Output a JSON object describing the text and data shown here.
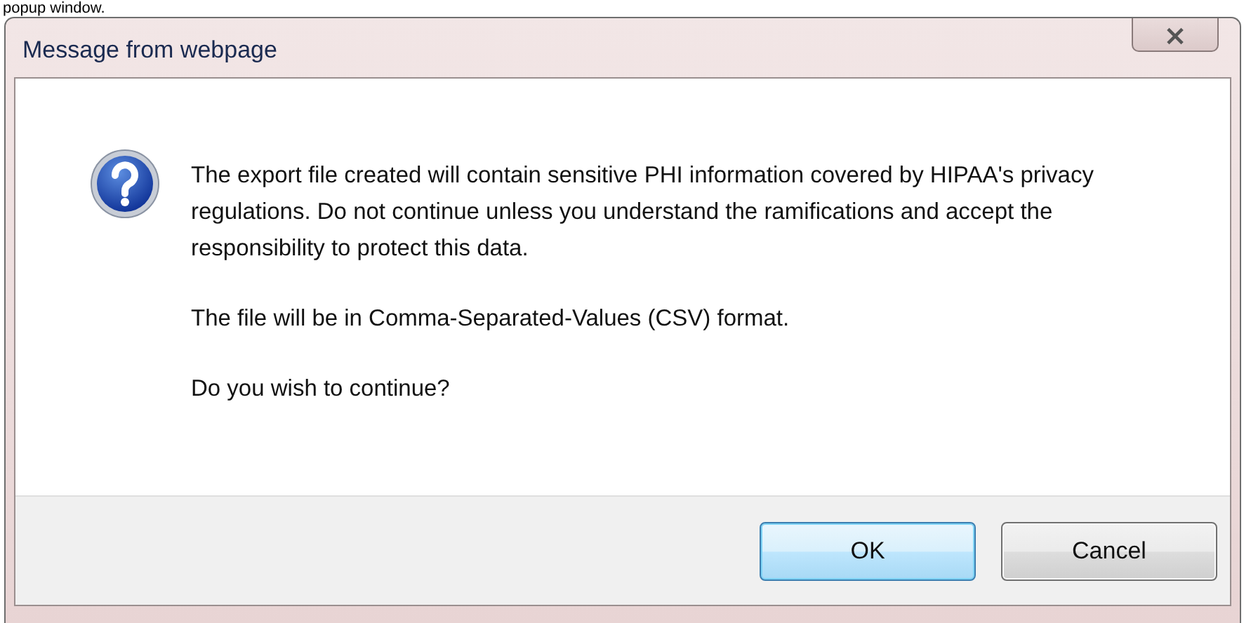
{
  "caption": "popup window.",
  "window": {
    "title": "Message from webpage",
    "close": "×"
  },
  "message": {
    "paragraphs": [
      "The export file created will contain sensitive PHI information covered by HIPAA's privacy regulations. Do not continue unless you understand the ramifications and accept the responsibility to protect this data.",
      "The file will be in Comma-Separated-Values (CSV) format.",
      "Do you wish to continue?"
    ]
  },
  "buttons": [
    {
      "label": "OK",
      "default": true
    },
    {
      "label": "Cancel",
      "default": false
    }
  ]
}
